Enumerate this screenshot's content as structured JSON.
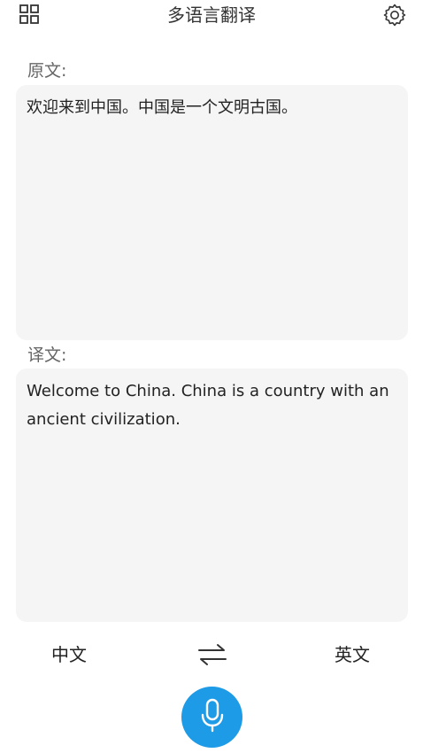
{
  "header": {
    "title": "多语言翻译",
    "left_icon": "grid-menu-icon",
    "right_icon": "gear-icon"
  },
  "source": {
    "label": "原文:",
    "text": "欢迎来到中国。中国是一个文明古国。"
  },
  "target": {
    "label": "译文:",
    "text": "Welcome to China. China is a country with an ancient civilization."
  },
  "languages": {
    "from": "中文",
    "to": "英文",
    "swap_icon": "swap-icon"
  },
  "mic": {
    "icon": "microphone-icon"
  },
  "colors": {
    "accent": "#1e9be6",
    "panel_bg": "#f5f5f5"
  }
}
